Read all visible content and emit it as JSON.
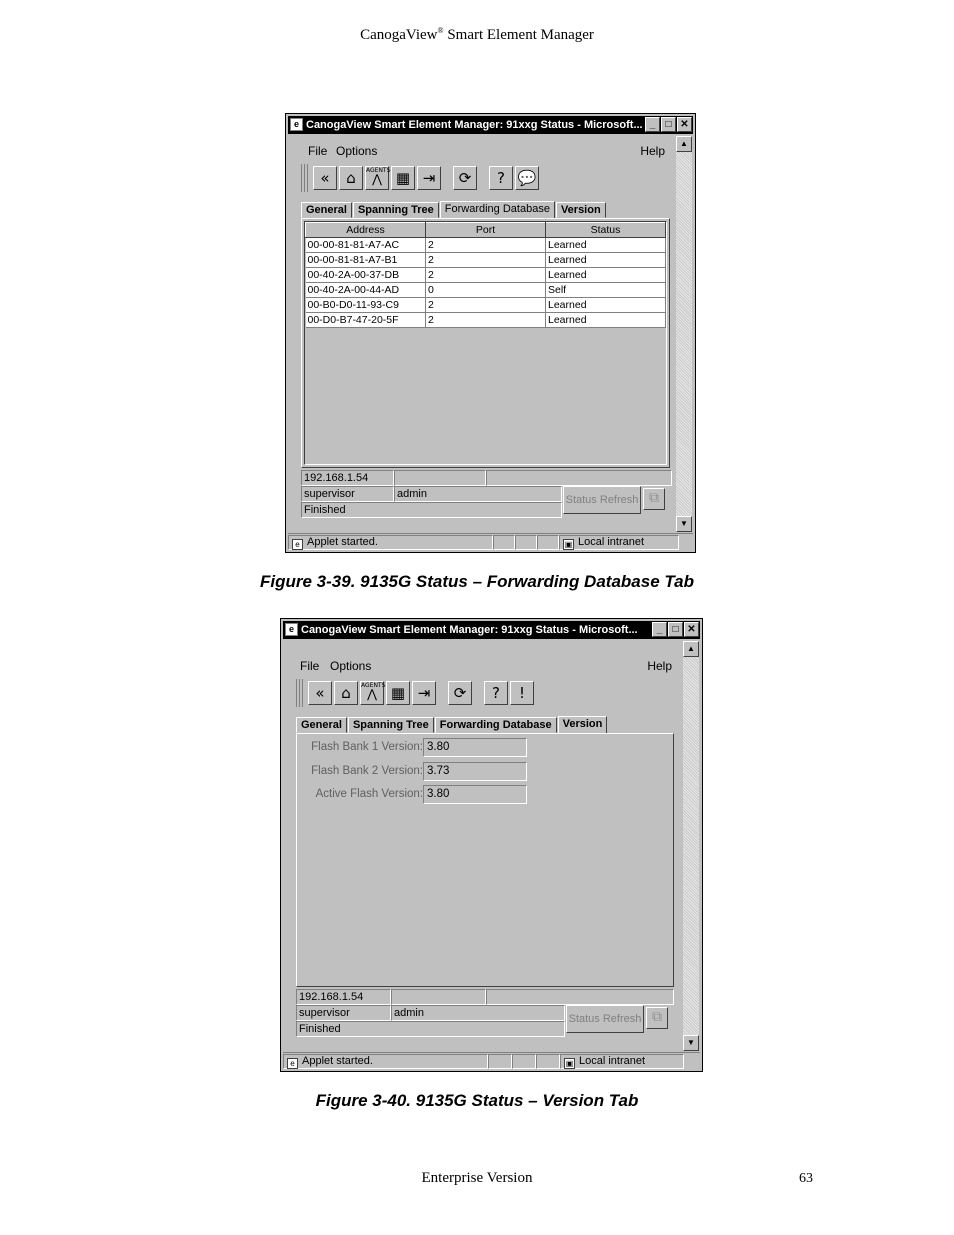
{
  "page": {
    "header_brand": "CanogaView",
    "header_reg": "®",
    "header_rest": " Smart Element Manager",
    "footer": "Enterprise Version",
    "page_number": "63"
  },
  "figure1": {
    "caption": "Figure 3-39. 9135G Status – Forwarding Database Tab",
    "window_title": "CanogaView Smart Element Manager: 91xxg Status - Microsoft...",
    "menu": {
      "file": "File",
      "options": "Options",
      "help": "Help"
    },
    "tabs": [
      "General",
      "Spanning Tree",
      "Forwarding Database",
      "Version"
    ],
    "active_tab": "Forwarding Database",
    "table": {
      "headers": [
        "Address",
        "Port",
        "Status"
      ],
      "rows": [
        [
          "00-00-81-81-A7-AC",
          "2",
          "Learned"
        ],
        [
          "00-00-81-81-A7-B1",
          "2",
          "Learned"
        ],
        [
          "00-40-2A-00-37-DB",
          "2",
          "Learned"
        ],
        [
          "00-40-2A-00-44-AD",
          "0",
          "Self"
        ],
        [
          "00-B0-D0-11-93-C9",
          "2",
          "Learned"
        ],
        [
          "00-D0-B7-47-20-5F",
          "2",
          "Learned"
        ]
      ]
    },
    "status": {
      "ip": "192.168.1.54",
      "user": "supervisor",
      "level": "admin",
      "state": "Finished",
      "refresh_button": "Status Refresh"
    },
    "statusbar": {
      "left": "Applet started.",
      "zone": "Local intranet"
    }
  },
  "figure2": {
    "caption": "Figure 3-40. 9135G Status – Version Tab",
    "window_title": "CanogaView Smart Element Manager: 91xxg Status - Microsoft...",
    "menu": {
      "file": "File",
      "options": "Options",
      "help": "Help"
    },
    "tabs": [
      "General",
      "Spanning Tree",
      "Forwarding Database",
      "Version"
    ],
    "active_tab": "Version",
    "versions": [
      {
        "label": "Flash Bank 1 Version:",
        "value": "3.80"
      },
      {
        "label": "Flash Bank 2 Version:",
        "value": "3.73"
      },
      {
        "label": "Active Flash Version:",
        "value": "3.80"
      }
    ],
    "status": {
      "ip": "192.168.1.54",
      "user": "supervisor",
      "level": "admin",
      "state": "Finished",
      "refresh_button": "Status Refresh"
    },
    "statusbar": {
      "left": "Applet started.",
      "zone": "Local intranet"
    }
  },
  "icons": [
    "back-icon",
    "home-icon",
    "agents-icon",
    "grid-icon",
    "exit-icon",
    "refresh-icon",
    "help-icon",
    "info-icon"
  ],
  "toolbar_agents_text": "AGENTS",
  "colors": {
    "title_bar": "#000000",
    "window_bg": "#c0c0c0",
    "table_bg": "#ffffff"
  }
}
